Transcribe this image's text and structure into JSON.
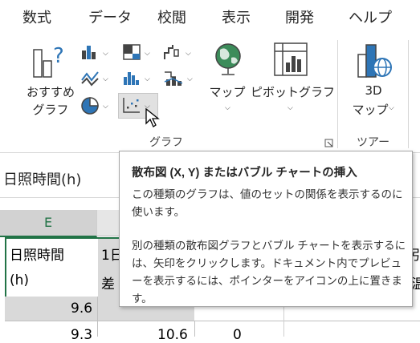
{
  "menu": {
    "tabs": [
      "数式",
      "データ",
      "校閲",
      "表示",
      "開発",
      "ヘルプ"
    ]
  },
  "ribbon": {
    "recommended_label_1": "おすすめ",
    "recommended_label_2": "グラフ",
    "maps_label": "マップ",
    "pivot_label": "ピボットグラフ",
    "map3d_label_1": "3D",
    "map3d_label_2": "マップ",
    "group_chart": "グラフ",
    "group_tour": "ツアー"
  },
  "formula_bar": {
    "name_box": "日照時間(h)"
  },
  "grid": {
    "col_e_header": "E",
    "e_header_line1": "日照時間",
    "e_header_line2": "(h)",
    "f_header_line1": "1日",
    "f_header_line2": "差",
    "e_row1": "9.6",
    "e_row2_partial": "9.3",
    "f_row2_partial": "10.6",
    "g_row2_partial": "0",
    "right_partial_1": "引",
    "right_partial_2": "温"
  },
  "tooltip": {
    "title": "散布図 (X, Y) またはバブル チャートの挿入",
    "para1": "この種類のグラフは、値のセットの関係を表示するのに使います。",
    "para2": "別の種類の散布図グラフとバブル チャートを表示するには、矢印をクリックします。ドキュメント内でプレビューを表示するには、ポインターをアイコンの上に置きます。"
  },
  "colors": {
    "accent_blue": "#2e75b6",
    "selected_cell_border": "#217346",
    "header_bg": "#e6e6e6"
  }
}
